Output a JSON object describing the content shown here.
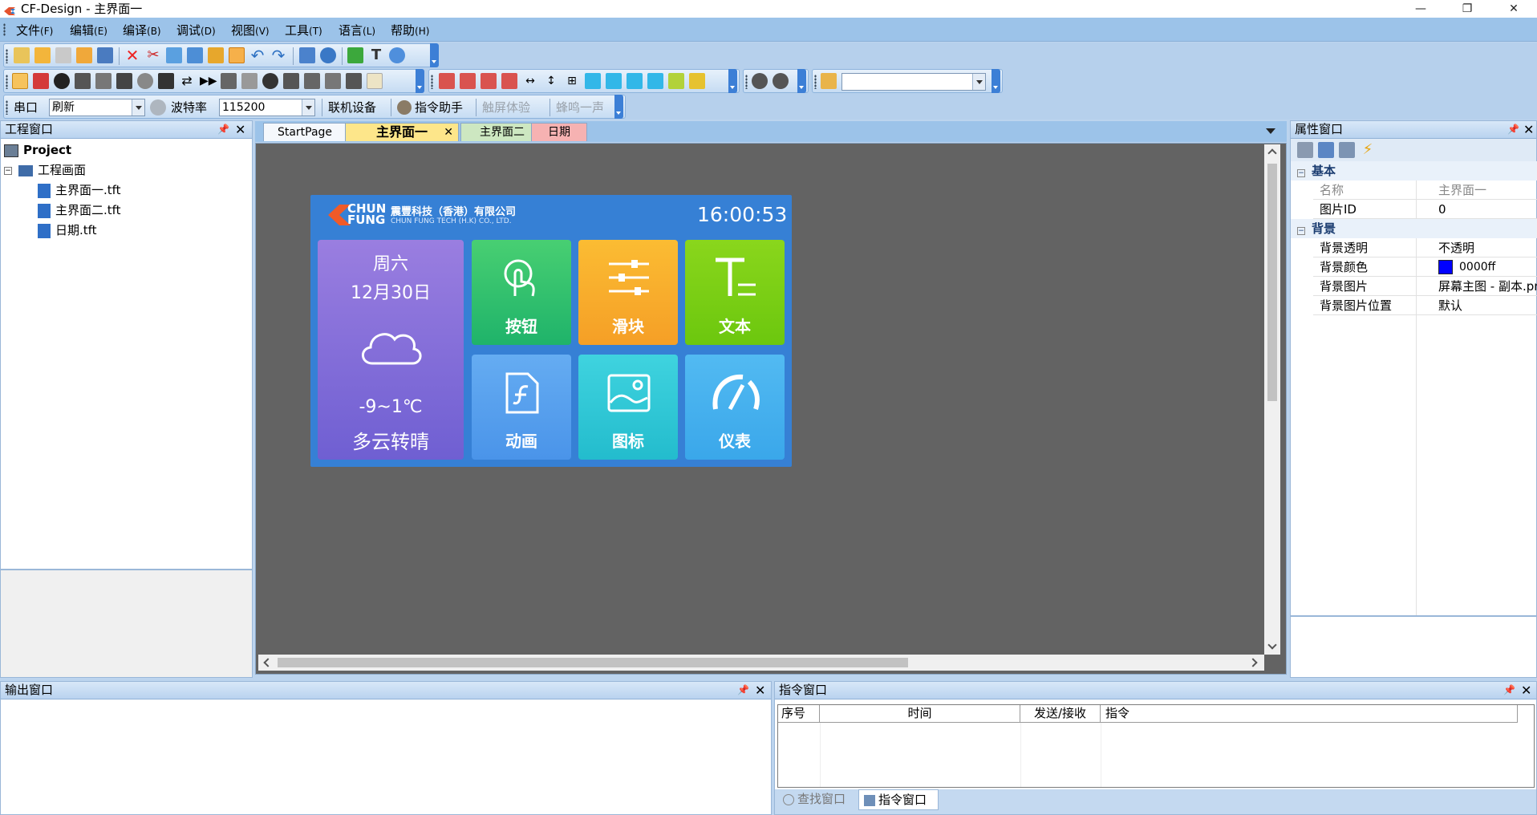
{
  "window": {
    "title": "CF-Design - 主界面一",
    "minimize": "—",
    "maximize": "❐",
    "close": "✕"
  },
  "menu": [
    {
      "label": "文件",
      "key": "(F)"
    },
    {
      "label": "编辑",
      "key": "(E)"
    },
    {
      "label": "编译",
      "key": "(B)"
    },
    {
      "label": "调试",
      "key": "(D)"
    },
    {
      "label": "视图",
      "key": "(V)"
    },
    {
      "label": "工具",
      "key": "(T)"
    },
    {
      "label": "语言",
      "key": "(L)"
    },
    {
      "label": "帮助",
      "key": "(H)"
    }
  ],
  "serial_toolbar": {
    "port_label": "串口",
    "port_value": "刷新",
    "baud_label": "波特率",
    "baud_value": "115200",
    "connect": "联机设备",
    "assistant": "指令助手",
    "touch": "触屏体验",
    "beep": "蜂鸣一声"
  },
  "project_panel": {
    "title": "工程窗口",
    "pin": "📌",
    "close": "✕",
    "root": "Project",
    "folder": "工程画面",
    "files": [
      "主界面一.tft",
      "主界面二.tft",
      "日期.tft"
    ]
  },
  "editor": {
    "tabs": [
      "StartPage",
      "主界面一",
      "主界面二",
      "日期"
    ],
    "active_tab_close": "✕"
  },
  "device": {
    "logo_text_1": "CHUN",
    "logo_text_2": "FUNG",
    "company_cn": "震豐科技（香港）有限公司",
    "company_en": "CHUN FUNG TECH (H.K) CO., LTD.",
    "time": "16:00:53",
    "weekday": "周六",
    "date": "12月30日",
    "temperature": "-9~1℃",
    "weather": "多云转晴",
    "tiles": [
      "按钮",
      "滑块",
      "文本",
      "动画",
      "图标",
      "仪表"
    ]
  },
  "prop_panel": {
    "title": "属性窗口",
    "pin": "📌",
    "close": "✕",
    "categories": [
      {
        "name": "基本",
        "rows": [
          {
            "name": "名称",
            "value": "主界面一"
          },
          {
            "name": "图片ID",
            "value": "0"
          }
        ]
      },
      {
        "name": "背景",
        "rows": [
          {
            "name": "背景透明",
            "value": "不透明"
          },
          {
            "name": "背景颜色",
            "value": "0000ff"
          },
          {
            "name": "背景图片",
            "value": "屏幕主图 - 副本.png"
          },
          {
            "name": "背景图片位置",
            "value": "默认"
          }
        ]
      }
    ],
    "bg_color_swatch": "#0000ff"
  },
  "output_panel": {
    "title": "输出窗口",
    "pin": "📌",
    "close": "✕"
  },
  "cmd_panel": {
    "title": "指令窗口",
    "pin": "📌",
    "close": "✕",
    "columns": [
      "序号",
      "时间",
      "发送/接收",
      "指令"
    ],
    "bottom_tabs": [
      "查找窗口",
      "指令窗口"
    ]
  },
  "colors": {
    "accent": "#3680d5",
    "tile_purple": "#8a6fd8",
    "tile_green": "#2fbf6e",
    "tile_orange": "#f7ac2a",
    "tile_lime": "#7ccc16",
    "tile_blue": "#5aa2ef",
    "tile_cyan": "#34c3d5",
    "tile_sky": "#4ab0ee"
  }
}
